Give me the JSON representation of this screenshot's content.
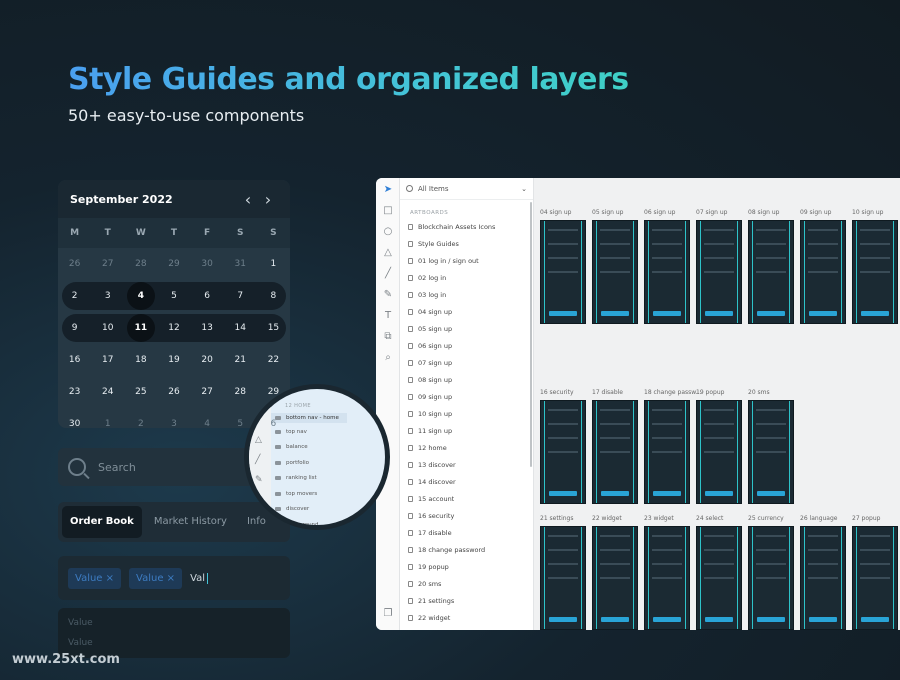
{
  "headline": "Style Guides and organized layers",
  "subheadline": "50+ easy-to-use components",
  "calendar": {
    "month_label": "September 2022",
    "weekdays": [
      "M",
      "T",
      "W",
      "T",
      "F",
      "S",
      "S"
    ],
    "rows": [
      [
        "26",
        "27",
        "28",
        "29",
        "30",
        "31",
        "1"
      ],
      [
        "2",
        "3",
        "4",
        "5",
        "6",
        "7",
        "8"
      ],
      [
        "9",
        "10",
        "11",
        "12",
        "13",
        "14",
        "15"
      ],
      [
        "16",
        "17",
        "18",
        "19",
        "20",
        "21",
        "22"
      ],
      [
        "23",
        "24",
        "25",
        "26",
        "27",
        "28",
        "29"
      ],
      [
        "30",
        "1",
        "2",
        "3",
        "4",
        "5",
        "6"
      ]
    ],
    "selected": [
      "4",
      "11"
    ]
  },
  "search": {
    "placeholder": "Search"
  },
  "tabs": {
    "order_book": "Order Book",
    "market_history": "Market History",
    "info": "Info"
  },
  "tag_input": {
    "tags": [
      "Value ×",
      "Value ×"
    ],
    "typed": "Val"
  },
  "value_list": [
    "Value",
    "Value"
  ],
  "watermark": "www.25xt.com",
  "editor": {
    "filter_label": "All Items",
    "section_label": "ARTBOARDS",
    "layers": [
      "Blockchain Assets Icons",
      "Style Guides",
      "01 log in / sign out",
      "02 log in",
      "03 log in",
      "04 sign up",
      "05 sign up",
      "06 sign up",
      "07 sign up",
      "08 sign up",
      "09 sign up",
      "10 sign up",
      "11 sign up",
      "12 home",
      "13 discover",
      "14 discover",
      "15 account",
      "16 security",
      "17 disable",
      "18 change password",
      "19 popup",
      "20 sms",
      "21 settings",
      "22 widget"
    ],
    "artboards_row1": [
      "04 sign up",
      "05 sign up",
      "06 sign up",
      "07 sign up",
      "08 sign up",
      "09 sign up",
      "10 sign up"
    ],
    "artboards_row2": [
      "16 security",
      "17 disable",
      "18 change passw...",
      "19 popup",
      "20 sms"
    ],
    "artboards_row3": [
      "21 settings",
      "22 widget",
      "23 widget",
      "24 select",
      "25 currency",
      "26 language",
      "27 popup"
    ]
  },
  "magnifier": {
    "section": "12 HOME",
    "items": [
      "bottom nav - home",
      "top nav",
      "balance",
      "portfolio",
      "ranking list",
      "top movers",
      "discover",
      "background"
    ]
  }
}
